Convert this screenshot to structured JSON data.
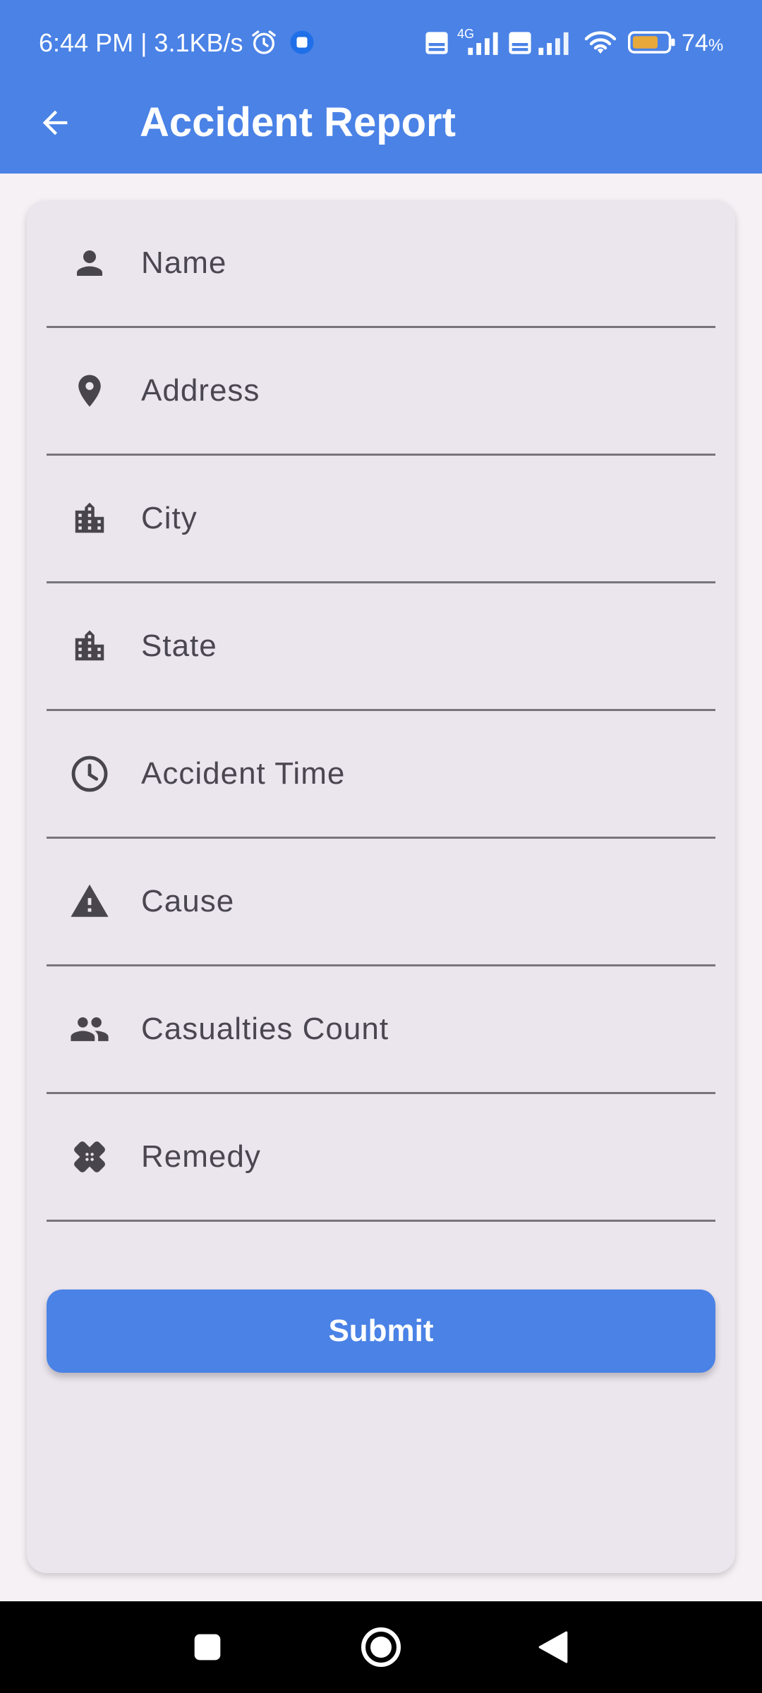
{
  "status_bar": {
    "time": "6:44 PM | 3.1KB/s",
    "network_type": "4G",
    "volte_label": "Vo LTE",
    "battery_percent": "74",
    "battery_unit": "%",
    "icons": [
      "alarm-icon",
      "notification-app-icon",
      "volte-icon",
      "signal-icon",
      "wifi-icon",
      "battery-icon"
    ]
  },
  "app_bar": {
    "title": "Accident Report",
    "back_icon": "arrow-back-icon"
  },
  "form": {
    "fields": [
      {
        "label": "Name",
        "icon": "person-icon"
      },
      {
        "label": "Address",
        "icon": "location-pin-icon"
      },
      {
        "label": "City",
        "icon": "city-building-icon"
      },
      {
        "label": "State",
        "icon": "state-building-icon"
      },
      {
        "label": "Accident Time",
        "icon": "clock-icon"
      },
      {
        "label": "Cause",
        "icon": "warning-icon"
      },
      {
        "label": "Casualties Count",
        "icon": "people-icon"
      },
      {
        "label": "Remedy",
        "icon": "bandage-icon"
      }
    ],
    "submit_label": "Submit"
  },
  "nav_bar": {
    "icons": [
      "recents-square-icon",
      "home-circle-icon",
      "back-triangle-icon"
    ]
  },
  "colors": {
    "primary": "#4a82e6",
    "card_background": "#ebe5ee",
    "page_background": "#f5f1f5",
    "label_text": "#4a4750",
    "icon": "#48464c",
    "divider": "#77757b"
  }
}
